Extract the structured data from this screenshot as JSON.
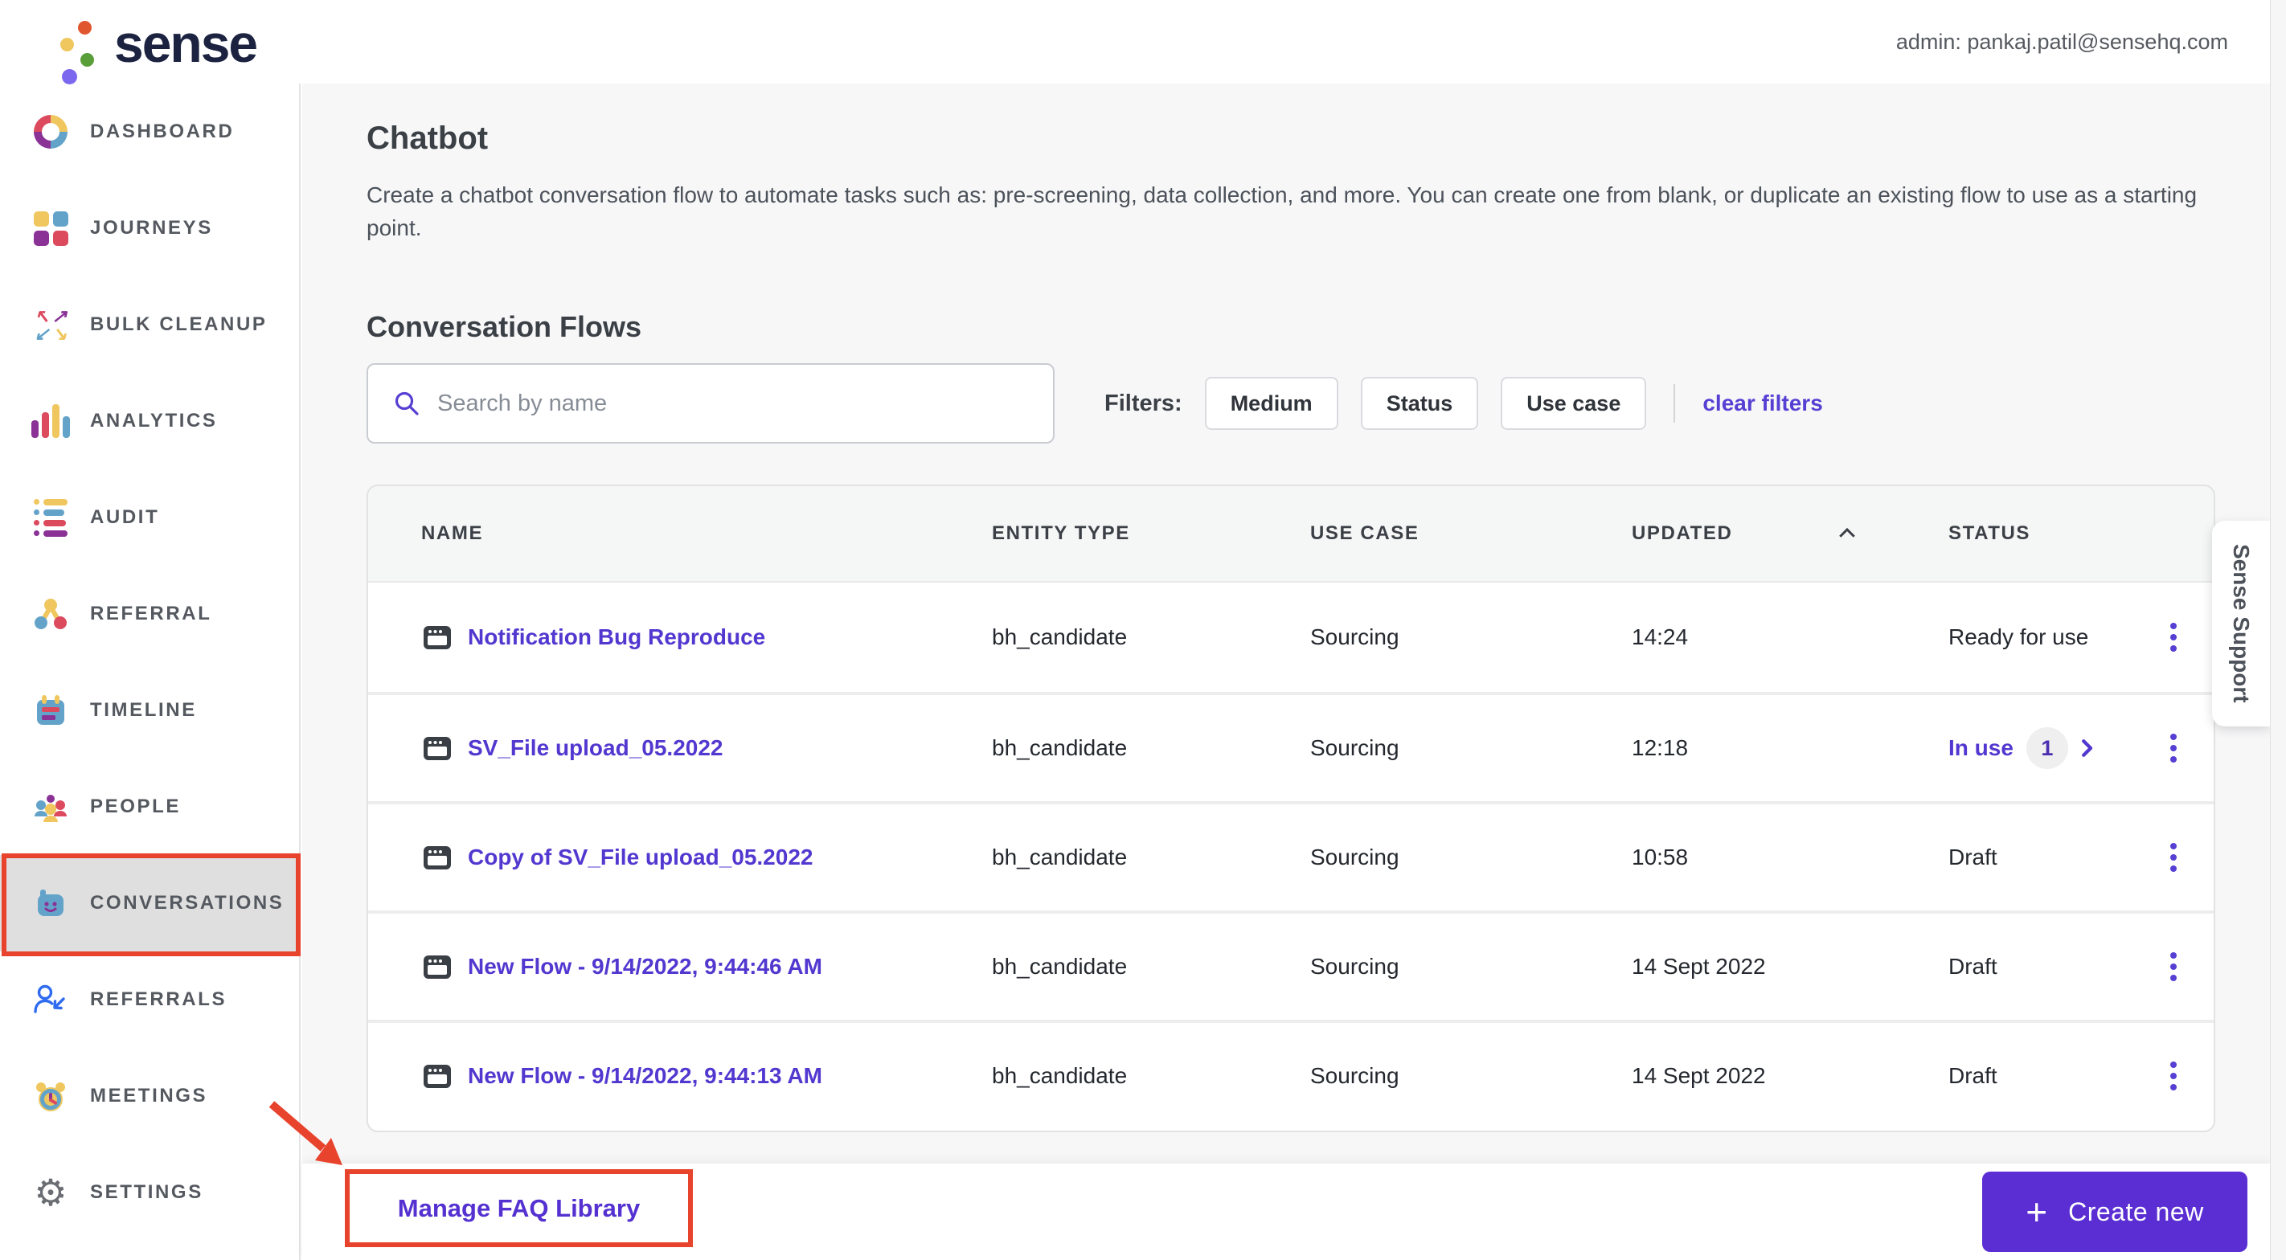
{
  "header": {
    "logo_text": "sense",
    "admin_label": "admin: pankaj.patil@sensehq.com"
  },
  "sidebar": {
    "items": [
      {
        "label": "DASHBOARD",
        "icon": "dashboard-icon",
        "active": false
      },
      {
        "label": "JOURNEYS",
        "icon": "journeys-icon",
        "active": false
      },
      {
        "label": "BULK CLEANUP",
        "icon": "bulk-cleanup-icon",
        "active": false
      },
      {
        "label": "ANALYTICS",
        "icon": "analytics-icon",
        "active": false
      },
      {
        "label": "AUDIT",
        "icon": "audit-icon",
        "active": false
      },
      {
        "label": "REFERRAL",
        "icon": "referral-icon",
        "active": false
      },
      {
        "label": "TIMELINE",
        "icon": "timeline-icon",
        "active": false
      },
      {
        "label": "PEOPLE",
        "icon": "people-icon",
        "active": false
      },
      {
        "label": "CONVERSATIONS",
        "icon": "conversations-icon",
        "active": true
      },
      {
        "label": "REFERRALS",
        "icon": "referrals-icon",
        "active": false
      },
      {
        "label": "MEETINGS",
        "icon": "meetings-icon",
        "active": false
      },
      {
        "label": "SETTINGS",
        "icon": "settings-icon",
        "active": false
      }
    ]
  },
  "page": {
    "title": "Chatbot",
    "description": "Create a chatbot conversation flow to automate tasks such as: pre-screening, data collection, and more. You can create one from blank, or duplicate an existing flow to use as a starting point.",
    "section_title": "Conversation Flows",
    "search": {
      "placeholder": "Search by name"
    },
    "filters": {
      "label": "Filters:",
      "buttons": [
        "Medium",
        "Status",
        "Use case"
      ],
      "clear_label": "clear filters"
    }
  },
  "table": {
    "columns": [
      "NAME",
      "ENTITY TYPE",
      "USE CASE",
      "UPDATED",
      "STATUS"
    ],
    "sorted_column": "UPDATED",
    "rows": [
      {
        "name": "Notification Bug Reproduce",
        "entity_type": "bh_candidate",
        "use_case": "Sourcing",
        "updated": "14:24",
        "status": "Ready for use"
      },
      {
        "name": "SV_File upload_05.2022",
        "entity_type": "bh_candidate",
        "use_case": "Sourcing",
        "updated": "12:18",
        "status": "In use",
        "in_use_count": "1"
      },
      {
        "name": "Copy of SV_File upload_05.2022",
        "entity_type": "bh_candidate",
        "use_case": "Sourcing",
        "updated": "10:58",
        "status": "Draft"
      },
      {
        "name": "New Flow - 9/14/2022, 9:44:46 AM",
        "entity_type": "bh_candidate",
        "use_case": "Sourcing",
        "updated": "14 Sept 2022",
        "status": "Draft"
      },
      {
        "name": "New Flow - 9/14/2022, 9:44:13 AM",
        "entity_type": "bh_candidate",
        "use_case": "Sourcing",
        "updated": "14 Sept 2022",
        "status": "Draft"
      }
    ]
  },
  "support_tab": {
    "label": "Sense Support"
  },
  "footer": {
    "manage_faq_label": "Manage FAQ Library",
    "create_new_label": "Create new"
  },
  "colors": {
    "accent_purple": "#5b2ed3",
    "link_purple": "#5338d0",
    "annotation_red": "#e8432d",
    "brand_yellow": "#efc75e",
    "brand_red": "#dc4a5e",
    "brand_blue": "#64a3c9",
    "brand_purple": "#8a3296"
  }
}
